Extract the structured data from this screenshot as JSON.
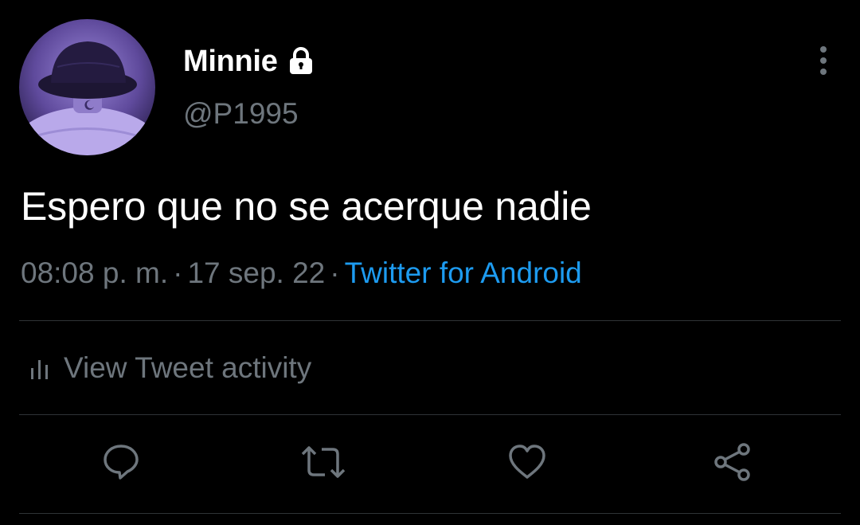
{
  "user": {
    "display_name": "Minnie",
    "handle": "@P1995",
    "protected_icon": "lock-icon",
    "avatar_icon": "avatar-photo"
  },
  "tweet": {
    "text": "Espero que no se acerque nadie",
    "time": "08:08 p. m.",
    "separator": "·",
    "date": "17 sep. 22",
    "source": "Twitter for Android"
  },
  "activity": {
    "label": "View Tweet activity",
    "icon": "bar-chart-icon"
  },
  "actions": [
    {
      "icon": "reply-icon"
    },
    {
      "icon": "retweet-icon"
    },
    {
      "icon": "like-icon"
    },
    {
      "icon": "share-icon"
    }
  ],
  "colors": {
    "background": "#000000",
    "text": "#ffffff",
    "secondary": "#6e767d",
    "link": "#1d9bf0",
    "divider": "#2f3336"
  }
}
